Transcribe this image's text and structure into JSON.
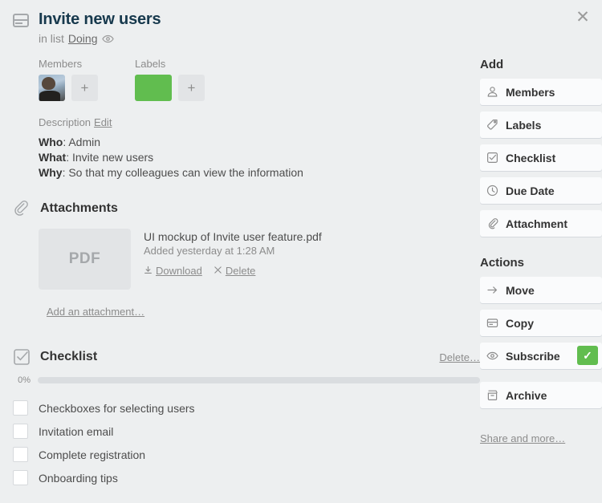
{
  "close_label": "✕",
  "header": {
    "card_icon": "card-icon",
    "title": "Invite new users",
    "in_list_prefix": "in list",
    "list_name": "Doing",
    "watch_icon": "eye-icon"
  },
  "members": {
    "heading": "Members",
    "add_label": "+"
  },
  "labels": {
    "heading": "Labels",
    "add_label": "+",
    "color": "#61bd4f"
  },
  "description": {
    "heading": "Description",
    "edit_label": "Edit",
    "lines": [
      {
        "key": "Who",
        "sep": ": ",
        "value": "Admin"
      },
      {
        "key": "What",
        "sep": ": ",
        "value": "Invite new users"
      },
      {
        "key": "Why",
        "sep": ": ",
        "value": "So that my colleagues can view the information"
      }
    ]
  },
  "attachments": {
    "heading": "Attachments",
    "icon": "paperclip-icon",
    "item": {
      "thumb_label": "PDF",
      "name": "UI mockup of Invite user feature.pdf",
      "added": "Added yesterday at 1:28 AM",
      "download_label": "Download",
      "delete_label": "Delete"
    },
    "add_label": "Add an attachment…"
  },
  "checklist": {
    "heading": "Checklist",
    "icon": "checklist-icon",
    "delete_label": "Delete…",
    "progress_pct": 0,
    "progress_label": "0%",
    "items": [
      {
        "label": "Checkboxes for selecting users",
        "checked": false
      },
      {
        "label": "Invitation email",
        "checked": false
      },
      {
        "label": "Complete registration",
        "checked": false
      },
      {
        "label": "Onboarding tips",
        "checked": false
      }
    ]
  },
  "sidebar": {
    "add_heading": "Add",
    "add_buttons": [
      {
        "label": "Members",
        "icon": "person-icon"
      },
      {
        "label": "Labels",
        "icon": "tag-icon"
      },
      {
        "label": "Checklist",
        "icon": "checklist-icon"
      },
      {
        "label": "Due Date",
        "icon": "clock-icon"
      },
      {
        "label": "Attachment",
        "icon": "paperclip-icon"
      }
    ],
    "actions_heading": "Actions",
    "action_buttons": [
      {
        "label": "Move",
        "icon": "arrow-right-icon"
      },
      {
        "label": "Copy",
        "icon": "card-icon"
      },
      {
        "label": "Subscribe",
        "icon": "eye-icon",
        "badge": "✓"
      },
      {
        "label": "Archive",
        "icon": "archive-icon"
      }
    ],
    "share_label": "Share and more…"
  }
}
